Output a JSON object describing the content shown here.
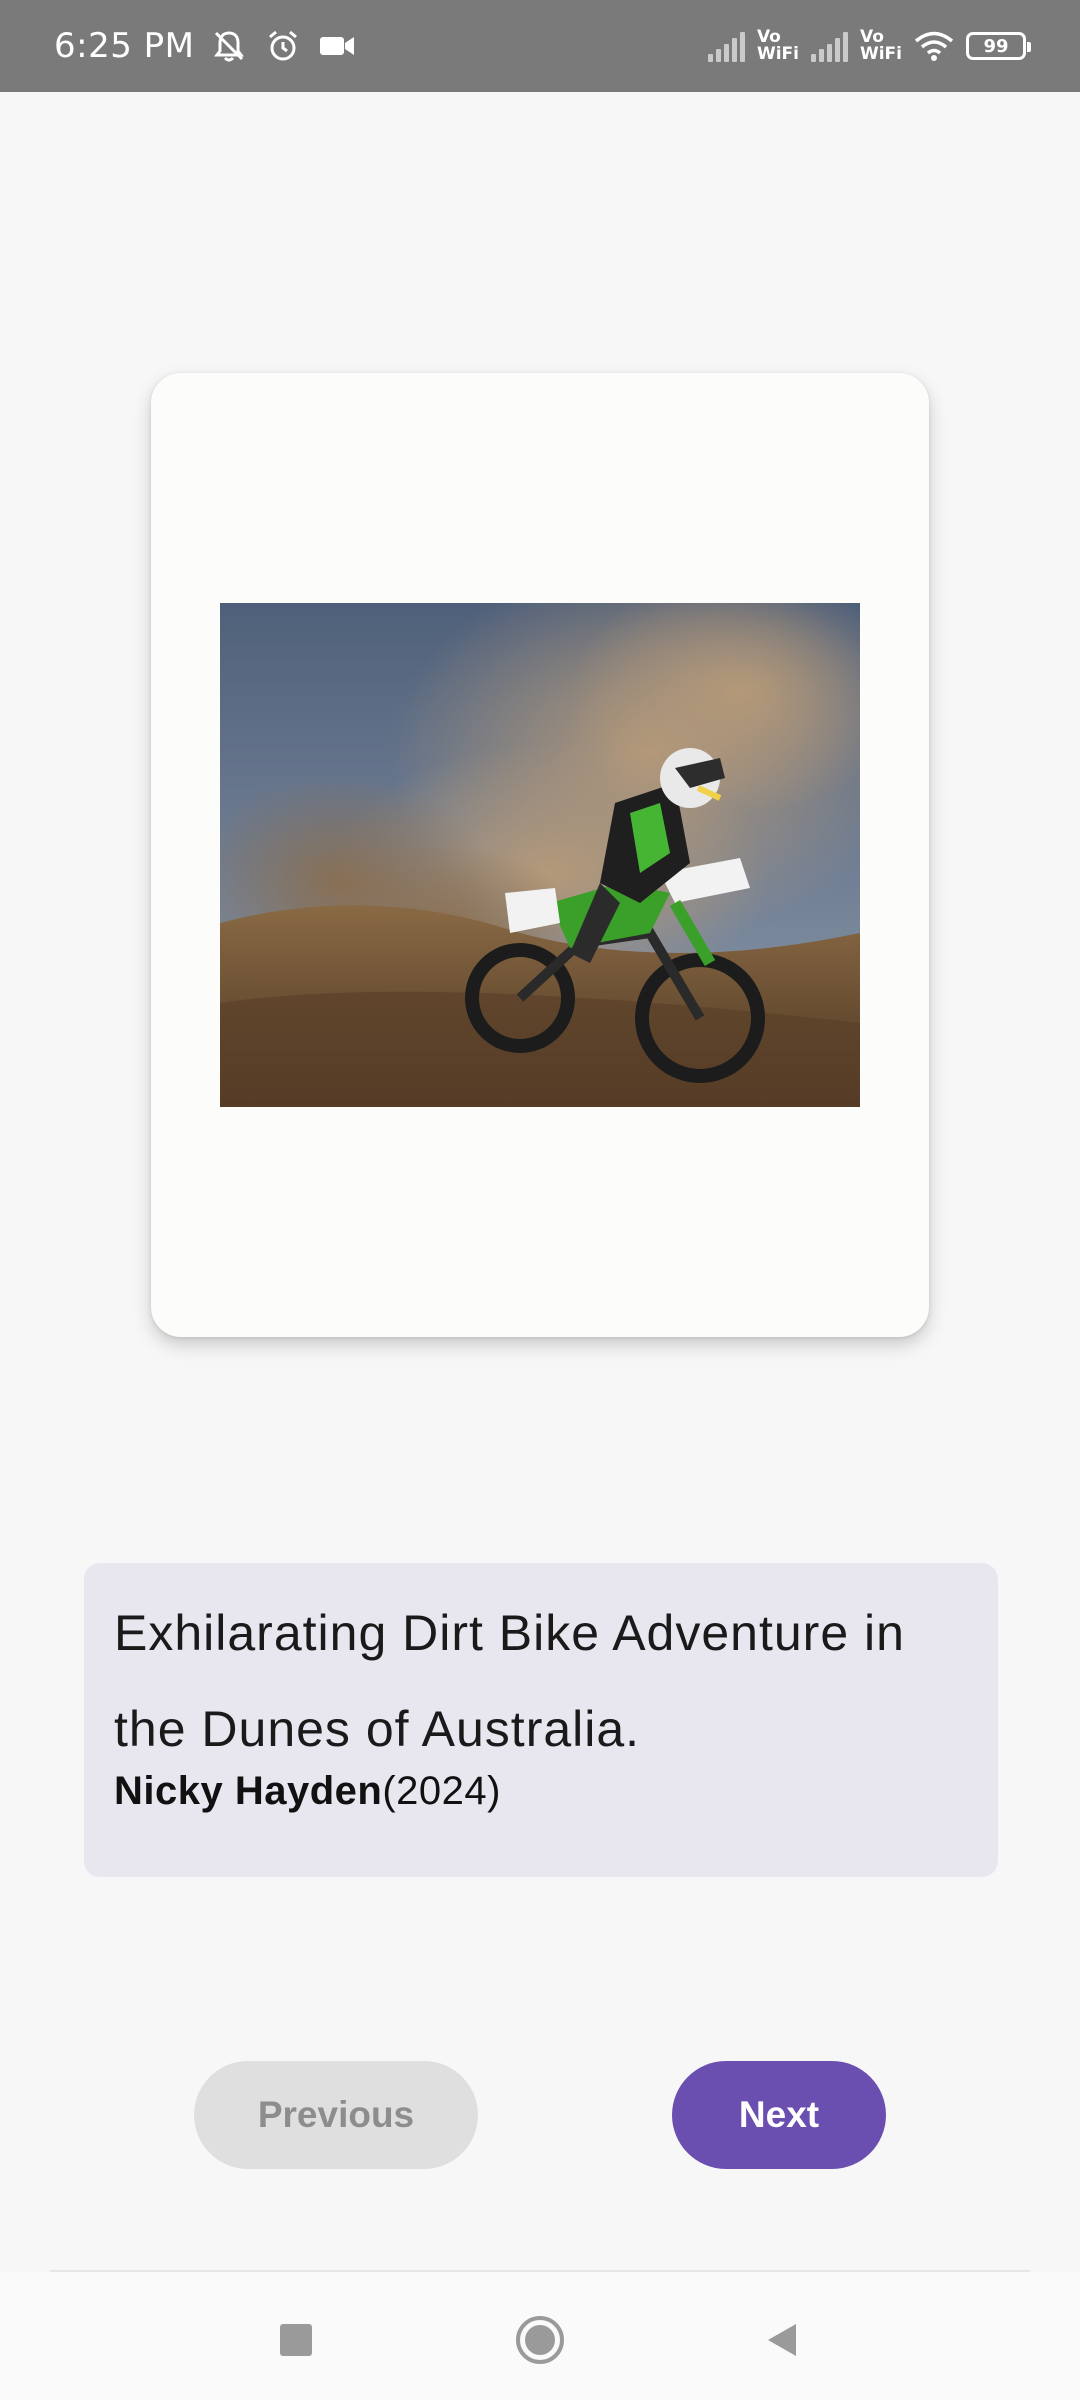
{
  "status_bar": {
    "time": "6:25 PM",
    "battery": "99",
    "vowifi_1": "Vo\nWiFi",
    "vowifi_2": "Vo\nWiFi",
    "icons": [
      "mute-icon",
      "alarm-icon",
      "video-camera-icon",
      "signal-icon",
      "wifi-icon",
      "battery-icon"
    ]
  },
  "card": {
    "image_subject": "motocross-photo"
  },
  "caption": {
    "title": "Exhilarating Dirt Bike Adventure in the Dunes of Australia.",
    "author": "Nicky Hayden",
    "year": "(2024)"
  },
  "buttons": {
    "previous_label": "Previous",
    "next_label": "Next"
  },
  "colors": {
    "accent": "#6a4fb0",
    "disabled_button": "#dfdfdf",
    "caption_background": "#e8e7ef"
  },
  "nav_bar": {
    "icons": [
      "recent-apps-icon",
      "home-icon",
      "back-icon"
    ]
  }
}
